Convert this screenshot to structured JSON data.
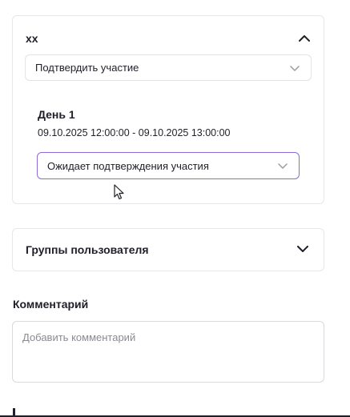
{
  "event": {
    "title": "xx",
    "confirm_select": {
      "value": "Подтвердить участие"
    },
    "day": {
      "title": "День 1",
      "range": "09.10.2025 12:00:00 - 09.10.2025 13:00:00",
      "status_select": {
        "value": "Ожидает подтверждения участия"
      }
    }
  },
  "groups": {
    "title": "Группы пользователя"
  },
  "comment": {
    "label": "Комментарий",
    "placeholder": "Добавить комментарий",
    "value": ""
  },
  "icons": {
    "collapse": "chevron-up-icon",
    "expand": "chevron-down-icon",
    "cursor": "mouse-pointer-icon"
  },
  "colors": {
    "accent_border": "#8e6ad8",
    "text": "#1f1f29",
    "border": "#e7e7ec",
    "placeholder": "#8a8a93"
  }
}
